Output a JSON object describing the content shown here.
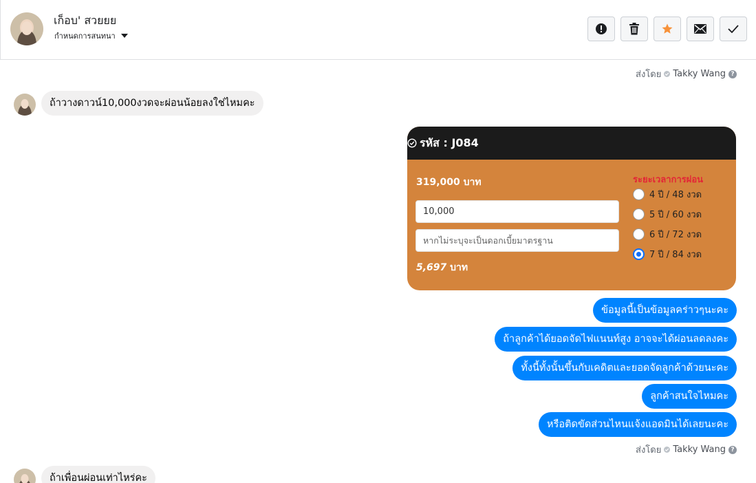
{
  "header": {
    "contact_name": "เก็อบ' สวยยย",
    "contact_sub": "กำหนดการสนทนา",
    "actions": [
      {
        "name": "report",
        "icon": "alert-circle-icon"
      },
      {
        "name": "delete",
        "icon": "trash-icon"
      },
      {
        "name": "star",
        "icon": "star-icon",
        "color": "#f7923a"
      },
      {
        "name": "mail",
        "icon": "envelope-icon"
      },
      {
        "name": "done",
        "icon": "check-icon"
      }
    ]
  },
  "sent_by": {
    "label": "ส่งโดย",
    "name": "Takky Wang"
  },
  "incoming": [
    "ถ้าวางดาวน์10,000งวดจะผ่อนน้อยลงใช่ไหมคะ",
    "ถ้าเพื่อนผ่อนเท่าไหร่คะ"
  ],
  "card": {
    "code": "รหัส : J084",
    "price": "319,000 บาท",
    "down_payment": "10,000",
    "interest_placeholder": "หากไม่ระบุจะเป็นดอกเบี้ยมาตรฐาน",
    "result_value": "5,697",
    "result_unit": "บาท",
    "term_title": "ระยะเวลาการผ่อน",
    "terms": [
      {
        "label": "4 ปี / 48 งวด",
        "selected": false
      },
      {
        "label": "5 ปี / 60 งวด",
        "selected": false
      },
      {
        "label": "6 ปี / 72 งวด",
        "selected": false
      },
      {
        "label": "7 ปี / 84 งวด",
        "selected": true
      }
    ],
    "bg_color": "#d4843c"
  },
  "outgoing": [
    "ข้อมูลนี้เป็นข้อมูลคร่าวๆนะคะ",
    "ถ้าลูกค้าได้ยอดจัดไฟแนนท์สูง อาจจะได้ผ่อนลดลงคะ",
    "ทั้งนี้ทั้งนั้นขึ้นกับเคดิตและยอดจัดลูกค้าด้วยนะคะ",
    "ลูกค้าสนใจไหมคะ",
    "หรือติดขัดส่วนไหนแจ้งแอดมินได้เลยนะคะ"
  ],
  "colors": {
    "accent": "#0084ff",
    "incoming_bubble": "#f1f0f0"
  }
}
